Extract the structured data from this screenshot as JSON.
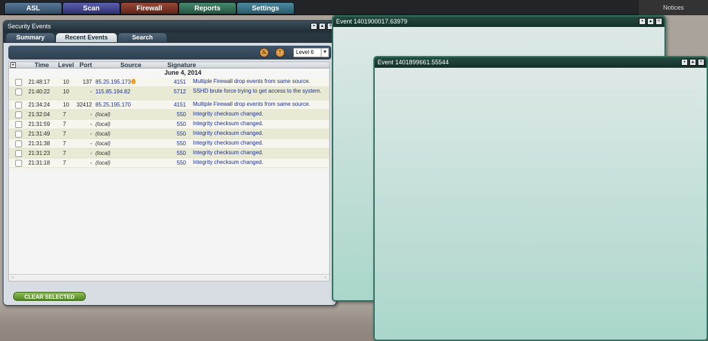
{
  "nav": {
    "tabs": [
      {
        "label": "ASL",
        "color": "#3b5a78"
      },
      {
        "label": "Scan",
        "color": "#3d3f84"
      },
      {
        "label": "Firewall",
        "color": "#7a3426"
      },
      {
        "label": "Reports",
        "color": "#2f6b53"
      },
      {
        "label": "Settings",
        "color": "#336a7c"
      }
    ],
    "notices": "Notices"
  },
  "security_window": {
    "title": "Security Events",
    "tabs": [
      "Summary",
      "Recent Events",
      "Search"
    ],
    "active_tab": "Recent Events",
    "level_select": "Level 6",
    "columns": {
      "time": "Time",
      "level": "Level",
      "port": "Port",
      "source": "Source",
      "signature": "Signature"
    },
    "date": "June 4, 2014",
    "rows": [
      {
        "time": "21:48:17",
        "level": "10",
        "port": "137",
        "source": "85.25.195.173",
        "signature": "4151",
        "description": "Multiple Firewall drop events from same source."
      },
      {
        "time": "21:40:22",
        "level": "10",
        "port": "-",
        "source": "115.85.194.82",
        "signature": "5712",
        "description": "SSHD brute force trying to get access to the system."
      },
      {
        "time": "21:34:24",
        "level": "10",
        "port": "32412",
        "source": "85.25.195.170",
        "signature": "4151",
        "description": "Multiple Firewall drop events from same source."
      },
      {
        "time": "21:32:04",
        "level": "7",
        "port": "-",
        "source": "(local)",
        "signature": "550",
        "description": "Integrity checksum changed."
      },
      {
        "time": "21:31:59",
        "level": "7",
        "port": "-",
        "source": "(local)",
        "signature": "550",
        "description": "Integrity checksum changed."
      },
      {
        "time": "21:31:49",
        "level": "7",
        "port": "-",
        "source": "(local)",
        "signature": "550",
        "description": "Integrity checksum changed."
      },
      {
        "time": "21:31:38",
        "level": "7",
        "port": "-",
        "source": "(local)",
        "signature": "550",
        "description": "Integrity checksum changed."
      },
      {
        "time": "21:31:23",
        "level": "7",
        "port": "-",
        "source": "(local)",
        "signature": "550",
        "description": "Integrity checksum changed."
      },
      {
        "time": "21:31:18",
        "level": "7",
        "port": "-",
        "source": "(local)",
        "signature": "550",
        "description": "Integrity checksum changed."
      }
    ],
    "clear_button": "CLEAR SELECTED"
  },
  "event_windows": [
    {
      "title": "Event 1401900017.63979"
    },
    {
      "title": "Event 1401899661.55544"
    }
  ]
}
